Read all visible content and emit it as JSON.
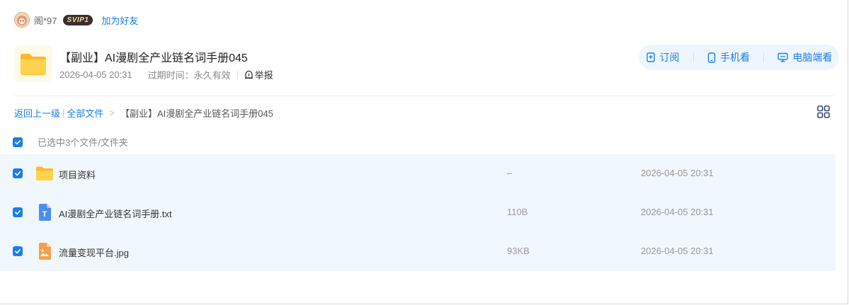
{
  "user": {
    "name": "阁*97",
    "vip_label": "SVIP1",
    "add_friend": "加为好友"
  },
  "share": {
    "title": "【副业】AI漫剧全产业链名词手册045",
    "date": "2026-04-05 20:31",
    "expire": "过期时间：永久有效",
    "report": "举报",
    "actions": {
      "subscribe": "订阅",
      "phone": "手机看",
      "pc": "电脑端看"
    }
  },
  "breadcrumb": {
    "back": "返回上一级",
    "all": "全部文件",
    "separator": ">",
    "current": "【副业】AI漫剧全产业链名词手册045"
  },
  "selection": {
    "text": "已选中3个文件/文件夹"
  },
  "files": [
    {
      "name": "项目资料",
      "size": "–",
      "date": "2026-04-05 20:31",
      "icon": "folder-icon",
      "checked": true
    },
    {
      "name": "AI漫剧全产业链名词手册.txt",
      "size": "110B",
      "date": "2026-04-05 20:31",
      "icon": "txt-file-icon",
      "checked": true
    },
    {
      "name": "流量变现平台.jpg",
      "size": "93KB",
      "date": "2026-04-05 20:31",
      "icon": "image-file-icon",
      "checked": true
    }
  ],
  "colors": {
    "accent": "#1a7ee8",
    "row_selected": "#f0f7fd",
    "folder": "#ffc83d"
  }
}
